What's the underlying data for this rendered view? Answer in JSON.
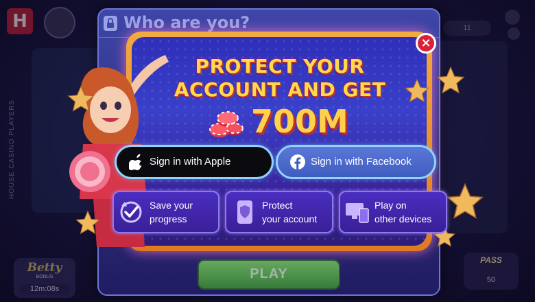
{
  "background": {
    "logo_letter": "H",
    "side_label": "HOUSE CASINO PLAYERS",
    "coins_chip": "11",
    "betty_bonus": {
      "title": "Betty",
      "subtitle": "BONUS",
      "timer": "12m:08s"
    },
    "pass": {
      "title": "PASS",
      "count": "50"
    },
    "play_label": "PLAY"
  },
  "modal": {
    "title": "Who are you?",
    "headline": "PROTECT YOUR ACCOUNT AND GET",
    "reward": "700M",
    "close_glyph": "×",
    "sign_in_apple": "Sign in with Apple",
    "sign_in_facebook": "Sign in with Facebook",
    "features": [
      {
        "line1": "Save your",
        "line2": "progress",
        "icon": "checkmark-cycle-icon"
      },
      {
        "line1": "Protect",
        "line2": "your account",
        "icon": "phone-shield-icon"
      },
      {
        "line1": "Play on",
        "line2": "other devices",
        "icon": "devices-icon"
      }
    ]
  },
  "colors": {
    "accent_gold": "#ffd84b",
    "close_red": "#d8233a",
    "facebook_blue": "#3f5cc0",
    "neon_border": "#8fd4ff"
  }
}
